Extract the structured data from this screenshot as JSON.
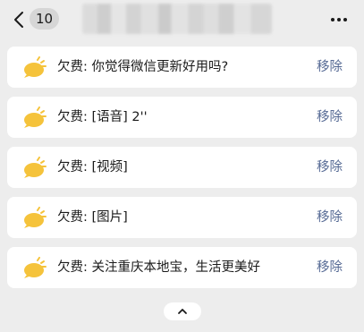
{
  "header": {
    "unread_count": "10",
    "back_icon": "chevron-left-icon",
    "more_icon": "ellipsis-icon"
  },
  "messages": [
    {
      "text": "欠费: 你觉得微信更新好用吗?",
      "action": "移除"
    },
    {
      "text": "欠费: [语音] 2''",
      "action": "移除"
    },
    {
      "text": "欠费: [视频]",
      "action": "移除"
    },
    {
      "text": "欠费: [图片]",
      "action": "移除"
    },
    {
      "text": "欠费: 关注重庆本地宝，生活更美好",
      "action": "移除"
    }
  ],
  "footer": {
    "collapse_icon": "chevron-up-icon"
  },
  "colors": {
    "background": "#ededed",
    "card": "#ffffff",
    "link": "#576b95",
    "icon": "#f5c33b"
  }
}
